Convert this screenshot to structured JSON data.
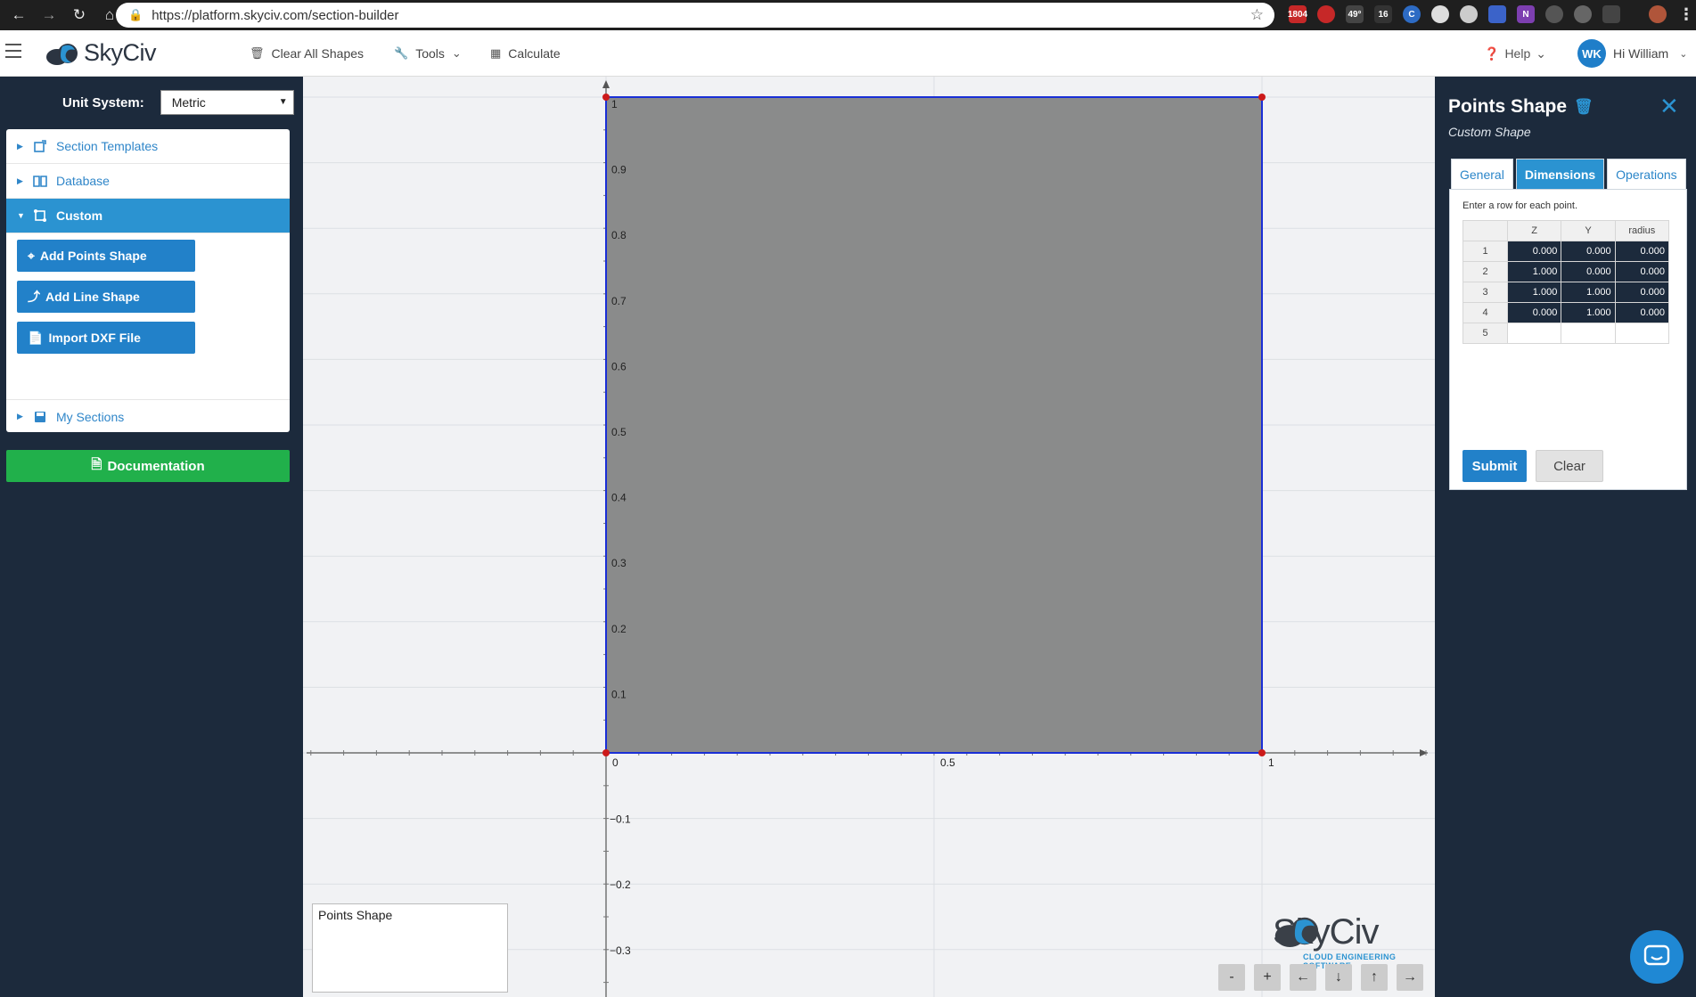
{
  "browser": {
    "url": "https://platform.skyciv.com/section-builder",
    "ext_badges": [
      "1804",
      "49°",
      "16"
    ]
  },
  "header": {
    "logo_text": "SkyCiv",
    "clear_all": "Clear All Shapes",
    "tools": "Tools",
    "calculate": "Calculate",
    "help": "Help",
    "avatar_initials": "WK",
    "greeting": "Hi William"
  },
  "sidebar": {
    "unit_label": "Unit System:",
    "unit_value": "Metric",
    "items": [
      {
        "label": "Section Templates"
      },
      {
        "label": "Database"
      },
      {
        "label": "Custom"
      },
      {
        "label": "My Sections"
      }
    ],
    "custom_buttons": [
      {
        "label": "Add Points Shape"
      },
      {
        "label": "Add Line Shape"
      },
      {
        "label": "Import DXF File"
      }
    ],
    "documentation": "Documentation"
  },
  "canvas": {
    "legend_text": "Points Shape",
    "watermark_text": "SkyCiv",
    "watermark_sub": "CLOUD ENGINEERING SOFTWARE",
    "shape_fill": "#8a8b8b",
    "shape_stroke": "#1a2fd6",
    "vertex_color": "#cc1a1a",
    "x_axis_labels": [
      "0",
      "0.5",
      "1"
    ],
    "y_axis_labels": [
      "1",
      "0.9",
      "0.8",
      "0.7",
      "0.6",
      "0.5",
      "0.4",
      "0.3",
      "0.2",
      "0.1"
    ],
    "neg_y_labels": [
      "−0.1",
      "−0.2",
      "−0.3"
    ],
    "controls": [
      "-",
      "+",
      "←",
      "↓",
      "↑",
      "→"
    ]
  },
  "right_panel": {
    "title": "Points Shape",
    "subtitle": "Custom Shape",
    "tabs": [
      "General",
      "Dimensions",
      "Operations"
    ],
    "active_tab": "Dimensions",
    "hint": "Enter a row for each point.",
    "columns": [
      "",
      "Z",
      "Y",
      "radius"
    ],
    "rows": [
      {
        "n": "1",
        "z": "0.000",
        "y": "0.000",
        "r": "0.000"
      },
      {
        "n": "2",
        "z": "1.000",
        "y": "0.000",
        "r": "0.000"
      },
      {
        "n": "3",
        "z": "1.000",
        "y": "1.000",
        "r": "0.000"
      },
      {
        "n": "4",
        "z": "0.000",
        "y": "1.000",
        "r": "0.000"
      },
      {
        "n": "5",
        "z": "",
        "y": "",
        "r": ""
      }
    ],
    "submit": "Submit",
    "clear": "Clear"
  },
  "colors": {
    "accent": "#2b93d1",
    "button_blue": "#2281c9",
    "green": "#21b04b",
    "sidebar_bg": "#1c2a3c"
  }
}
